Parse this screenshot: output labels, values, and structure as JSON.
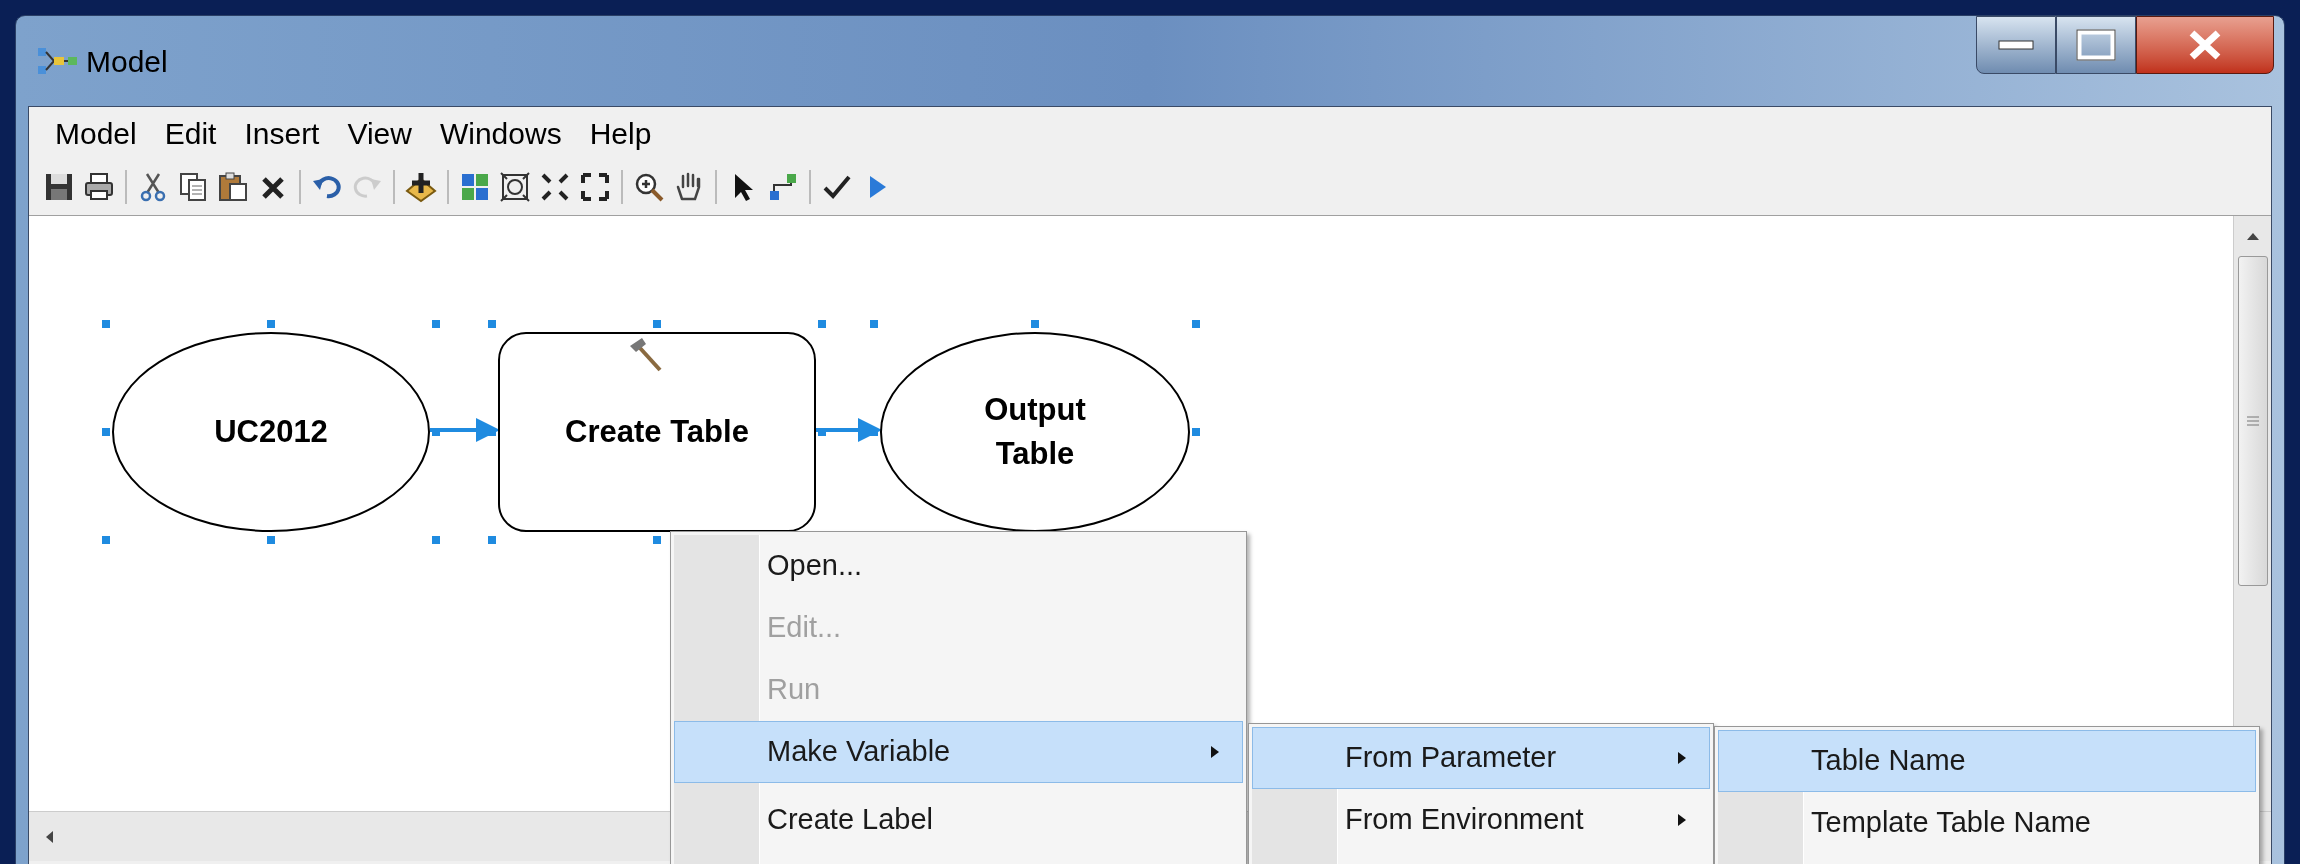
{
  "window": {
    "title": "Model"
  },
  "menu_bar": [
    {
      "label": "Model"
    },
    {
      "label": "Edit"
    },
    {
      "label": "Insert"
    },
    {
      "label": "View"
    },
    {
      "label": "Windows"
    },
    {
      "label": "Help"
    }
  ],
  "toolbar": [
    [
      {
        "kind": "save",
        "disabled": false
      },
      {
        "kind": "print",
        "disabled": false
      }
    ],
    [
      {
        "kind": "cut",
        "disabled": false
      },
      {
        "kind": "copy",
        "disabled": false
      },
      {
        "kind": "paste",
        "disabled": false
      },
      {
        "kind": "delete",
        "disabled": false
      }
    ],
    [
      {
        "kind": "undo",
        "disabled": false
      },
      {
        "kind": "redo",
        "disabled": true
      }
    ],
    [
      {
        "kind": "add",
        "disabled": false
      }
    ],
    [
      {
        "kind": "layout",
        "disabled": false
      },
      {
        "kind": "extent",
        "disabled": false
      },
      {
        "kind": "zoomin-fixed",
        "disabled": false
      },
      {
        "kind": "zoomout-fixed",
        "disabled": false
      }
    ],
    [
      {
        "kind": "zoom",
        "disabled": false
      },
      {
        "kind": "pan",
        "disabled": false
      }
    ],
    [
      {
        "kind": "select",
        "disabled": false
      },
      {
        "kind": "connect",
        "disabled": false
      }
    ],
    [
      {
        "kind": "validate",
        "disabled": false
      },
      {
        "kind": "run",
        "disabled": false
      }
    ]
  ],
  "diagram": {
    "nodes": [
      {
        "kind": "variable",
        "label": "UC2012",
        "selected": true
      },
      {
        "kind": "tool",
        "label": "Create Table",
        "selected": true
      },
      {
        "kind": "variable",
        "label": "Output Table",
        "selected": true
      }
    ]
  },
  "context_menu": {
    "items": [
      {
        "label": "Open...",
        "disabled": false,
        "selected": false,
        "submenu": false
      },
      {
        "label": "Edit...",
        "disabled": true,
        "selected": false,
        "submenu": false
      },
      {
        "label": "Run",
        "disabled": true,
        "selected": false,
        "submenu": false
      },
      {
        "label": "Make Variable",
        "disabled": false,
        "selected": true,
        "submenu": true
      },
      {
        "label": "Create Label",
        "disabled": false,
        "selected": false,
        "submenu": false
      }
    ]
  },
  "submenu": {
    "items": [
      {
        "label": "From Parameter",
        "selected": true,
        "submenu": true
      },
      {
        "label": "From Environment",
        "selected": false,
        "submenu": true
      }
    ]
  },
  "submenu_2": {
    "items": [
      {
        "label": "Table Name",
        "selected": true
      },
      {
        "label": "Template Table Name",
        "selected": false
      }
    ]
  }
}
